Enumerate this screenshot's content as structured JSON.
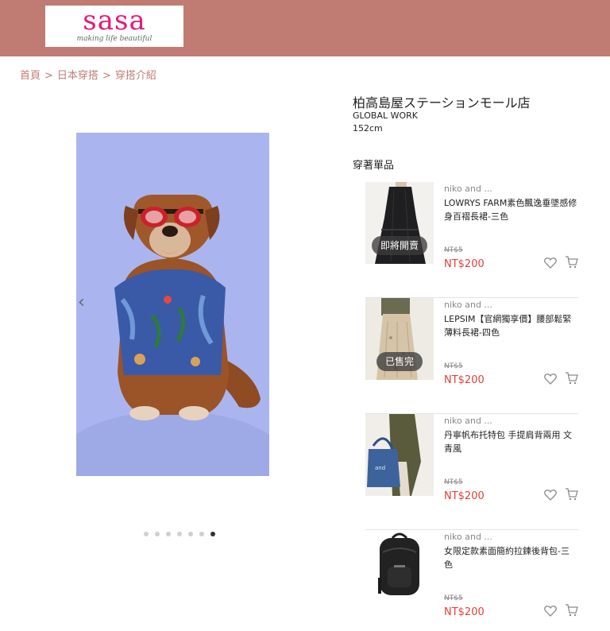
{
  "header": {
    "logo_text": "sasa",
    "logo_tagline": "making life beautiful",
    "brand_color": "#c07c72",
    "logo_color": "#e5197b"
  },
  "breadcrumb": [
    "首頁",
    "日本穿搭",
    "穿搭介紹"
  ],
  "breadcrumb_separator": ">",
  "gallery": {
    "prev_icon": "‹",
    "slides": 7,
    "active_slide": 7
  },
  "store": {
    "title": "柏高島屋ステーションモール店",
    "brand": "GLOBAL WORK",
    "height": "152cm"
  },
  "items_heading": "穿著單品",
  "products": [
    {
      "brand": "niko and ...",
      "name": "LOWRYS FARM素色飄逸垂墜感修身百褶長裙-三色",
      "old_price": "NT$5",
      "price": "NT$200",
      "badge": "即將開賣"
    },
    {
      "brand": "niko and ...",
      "name": "LEPSIM【官網獨享價】腰部鬆緊薄料長裙-四色",
      "old_price": "NT$5",
      "price": "NT$200",
      "badge": "已售完"
    },
    {
      "brand": "niko and ...",
      "name": "丹寧帆布托特包 手提肩背兩用 文青風",
      "old_price": "NT$5",
      "price": "NT$200",
      "badge": ""
    },
    {
      "brand": "niko and ...",
      "name": "女限定款素面簡約拉鍊後背包-三色",
      "old_price": "NT$5",
      "price": "NT$200",
      "badge": ""
    }
  ],
  "colors": {
    "price": "#e0403a",
    "badge_bg": "#3c3c3c"
  }
}
